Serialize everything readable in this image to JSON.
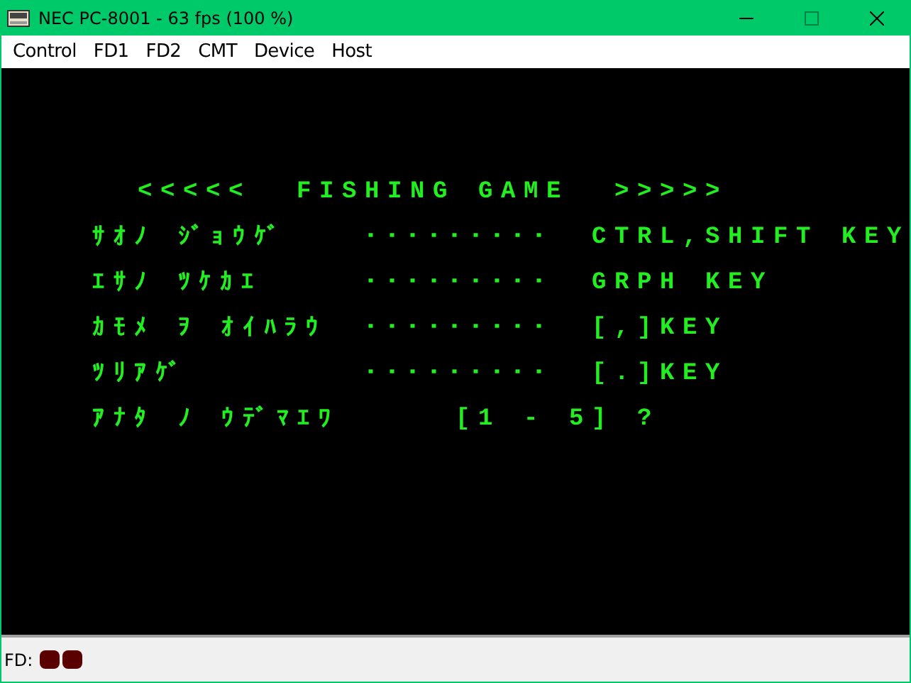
{
  "window": {
    "title": "NEC PC-8001 - 63 fps (100 %)",
    "maximize_disabled": true
  },
  "menu": [
    "Control",
    "FD1",
    "FD2",
    "CMT",
    "Device",
    "Host"
  ],
  "screen": {
    "title": "<<<<<  FISHING GAME  >>>>>",
    "rows": [
      {
        "label": "ｻｵﾉ ｼﾞｮｳｹﾞ",
        "dots": "･････････",
        "key": "CTRL,SHIFT KEY"
      },
      {
        "label": "ｴｻﾉ ﾂｹｶｴ",
        "dots": "･････････",
        "key": "GRPH KEY"
      },
      {
        "label": "ｶﾓﾒ ｦ ｵｲﾊﾗｳ",
        "dots": "･････････",
        "key": "[,]KEY"
      },
      {
        "label": "ﾂﾘｱｹﾞ",
        "dots": "･････････",
        "key": "[.]KEY"
      }
    ],
    "prompt": {
      "label": "ｱﾅﾀ ﾉ ｳﾃﾞﾏｴﾜ",
      "input": "[1 - 5] ?"
    }
  },
  "status": {
    "label": "FD:",
    "drives": [
      {
        "active": false
      },
      {
        "active": false
      }
    ]
  }
}
